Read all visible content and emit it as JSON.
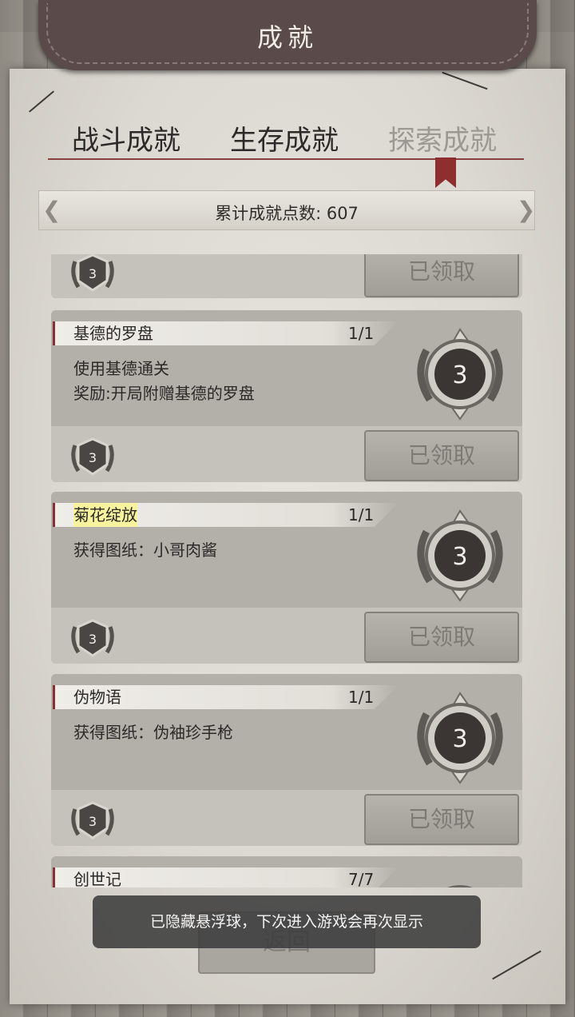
{
  "header": {
    "title": "成就"
  },
  "tabs": [
    {
      "label": "战斗成就",
      "active": false
    },
    {
      "label": "生存成就",
      "active": false
    },
    {
      "label": "探索成就",
      "active": true
    }
  ],
  "points": {
    "label": "累计成就点数: 607"
  },
  "partial_top_card": {
    "badge_value": "3",
    "button_label": "已领取"
  },
  "achievements": [
    {
      "name": "基德的罗盘",
      "progress": "1/1",
      "description": "使用基德通关\n奖励:开局附赠基德的罗盘",
      "badge_value": "3",
      "small_badge_value": "3",
      "button_label": "已领取"
    },
    {
      "name": "菊花绽放",
      "progress": "1/1",
      "description": "获得图纸：小哥肉酱",
      "badge_value": "3",
      "small_badge_value": "3",
      "button_label": "已领取"
    },
    {
      "name": "伪物语",
      "progress": "1/1",
      "description": "获得图纸：伪袖珍手枪",
      "badge_value": "3",
      "small_badge_value": "3",
      "button_label": "已领取"
    }
  ],
  "partial_bottom_card": {
    "name": "创世记",
    "progress": "7/7"
  },
  "back_button": {
    "label": "返回"
  },
  "toast": {
    "message": "已隐藏悬浮球，下次进入游戏会再次显示"
  },
  "colors": {
    "accent_red": "#8e2e2e",
    "banner": "#5a4a49"
  }
}
